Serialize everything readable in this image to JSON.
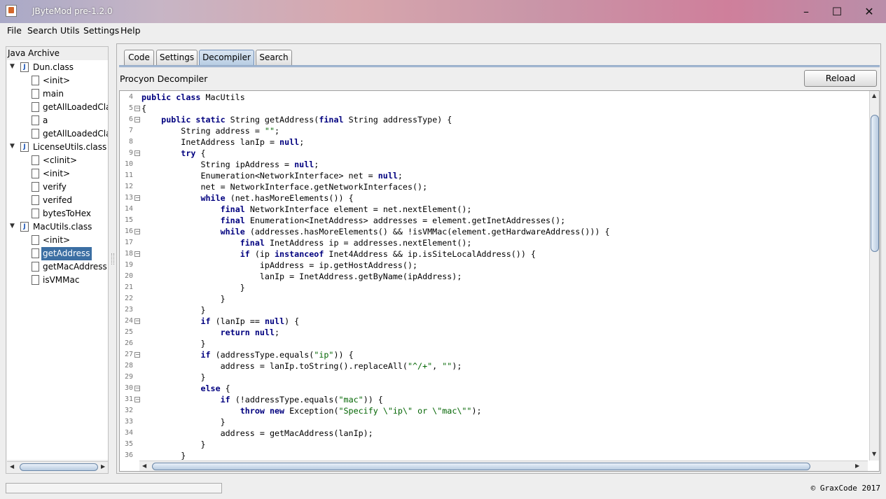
{
  "window": {
    "title": "JByteMod pre-1.2.0",
    "minimize_icon": "minimize-icon",
    "maximize_icon": "maximize-icon",
    "close_icon": "close-icon"
  },
  "menu": [
    "File",
    "Search",
    "Utils",
    "Settings",
    "Help"
  ],
  "sidebar": {
    "title": "Java Archive",
    "nodes": [
      {
        "label": "Dun.class",
        "kind": "class",
        "depth": 0,
        "expanded": true
      },
      {
        "label": "<init>",
        "kind": "method",
        "depth": 1
      },
      {
        "label": "main",
        "kind": "method",
        "depth": 1
      },
      {
        "label": "getAllLoadedClas",
        "kind": "method",
        "depth": 1
      },
      {
        "label": "a",
        "kind": "method",
        "depth": 1
      },
      {
        "label": "getAllLoadedClas",
        "kind": "method",
        "depth": 1
      },
      {
        "label": "LicenseUtils.class",
        "kind": "class",
        "depth": 0,
        "expanded": true
      },
      {
        "label": "<clinit>",
        "kind": "method",
        "depth": 1
      },
      {
        "label": "<init>",
        "kind": "method",
        "depth": 1
      },
      {
        "label": "verify",
        "kind": "method",
        "depth": 1
      },
      {
        "label": "verifed",
        "kind": "method",
        "depth": 1
      },
      {
        "label": "bytesToHex",
        "kind": "method",
        "depth": 1
      },
      {
        "label": "MacUtils.class",
        "kind": "class",
        "depth": 0,
        "expanded": true
      },
      {
        "label": "<init>",
        "kind": "method",
        "depth": 1
      },
      {
        "label": "getAddress",
        "kind": "method",
        "depth": 1,
        "selected": true
      },
      {
        "label": "getMacAddress",
        "kind": "method",
        "depth": 1
      },
      {
        "label": "isVMMac",
        "kind": "method",
        "depth": 1
      }
    ]
  },
  "tabs": [
    {
      "label": "Code"
    },
    {
      "label": "Settings"
    },
    {
      "label": "Decompiler",
      "active": true
    },
    {
      "label": "Search"
    }
  ],
  "decompiler": {
    "title": "Procyon Decompiler",
    "reload_label": "Reload"
  },
  "code_lines": [
    {
      "n": "4",
      "fold": false,
      "parts": [
        [
          "kw",
          "public class "
        ],
        [
          "",
          "MacUtils"
        ]
      ]
    },
    {
      "n": "5",
      "fold": true,
      "parts": [
        [
          "",
          "{"
        ]
      ]
    },
    {
      "n": "6",
      "fold": true,
      "parts": [
        [
          "",
          "    "
        ],
        [
          "kw",
          "public static "
        ],
        [
          "",
          "String getAddress("
        ],
        [
          "kw",
          "final "
        ],
        [
          "",
          "String addressType) {"
        ]
      ]
    },
    {
      "n": "7",
      "fold": false,
      "parts": [
        [
          "",
          "        String address = "
        ],
        [
          "str",
          "\"\""
        ],
        [
          "",
          ";"
        ]
      ]
    },
    {
      "n": "8",
      "fold": false,
      "parts": [
        [
          "",
          "        InetAddress lanIp = "
        ],
        [
          "kw",
          "null"
        ],
        [
          "",
          ";"
        ]
      ]
    },
    {
      "n": "9",
      "fold": true,
      "parts": [
        [
          "",
          "        "
        ],
        [
          "kw",
          "try "
        ],
        [
          "",
          "{"
        ]
      ]
    },
    {
      "n": "10",
      "fold": false,
      "parts": [
        [
          "",
          "            String ipAddress = "
        ],
        [
          "kw",
          "null"
        ],
        [
          "",
          ";"
        ]
      ]
    },
    {
      "n": "11",
      "fold": false,
      "parts": [
        [
          "",
          "            Enumeration<NetworkInterface> net = "
        ],
        [
          "kw",
          "null"
        ],
        [
          "",
          ";"
        ]
      ]
    },
    {
      "n": "12",
      "fold": false,
      "parts": [
        [
          "",
          "            net = NetworkInterface.getNetworkInterfaces();"
        ]
      ]
    },
    {
      "n": "13",
      "fold": true,
      "parts": [
        [
          "",
          "            "
        ],
        [
          "kw",
          "while "
        ],
        [
          "",
          "(net.hasMoreElements()) {"
        ]
      ]
    },
    {
      "n": "14",
      "fold": false,
      "parts": [
        [
          "",
          "                "
        ],
        [
          "kw",
          "final "
        ],
        [
          "",
          "NetworkInterface element = net.nextElement();"
        ]
      ]
    },
    {
      "n": "15",
      "fold": false,
      "parts": [
        [
          "",
          "                "
        ],
        [
          "kw",
          "final "
        ],
        [
          "",
          "Enumeration<InetAddress> addresses = element.getInetAddresses();"
        ]
      ]
    },
    {
      "n": "16",
      "fold": true,
      "parts": [
        [
          "",
          "                "
        ],
        [
          "kw",
          "while "
        ],
        [
          "",
          "(addresses.hasMoreElements() && !isVMMac(element.getHardwareAddress())) {"
        ]
      ]
    },
    {
      "n": "17",
      "fold": false,
      "parts": [
        [
          "",
          "                    "
        ],
        [
          "kw",
          "final "
        ],
        [
          "",
          "InetAddress ip = addresses.nextElement();"
        ]
      ]
    },
    {
      "n": "18",
      "fold": true,
      "parts": [
        [
          "",
          "                    "
        ],
        [
          "kw",
          "if "
        ],
        [
          "",
          "(ip "
        ],
        [
          "kw",
          "instanceof "
        ],
        [
          "",
          "Inet4Address && ip.isSiteLocalAddress()) {"
        ]
      ]
    },
    {
      "n": "19",
      "fold": false,
      "parts": [
        [
          "",
          "                        ipAddress = ip.getHostAddress();"
        ]
      ]
    },
    {
      "n": "20",
      "fold": false,
      "parts": [
        [
          "",
          "                        lanIp = InetAddress.getByName(ipAddress);"
        ]
      ]
    },
    {
      "n": "21",
      "fold": false,
      "parts": [
        [
          "",
          "                    }"
        ]
      ]
    },
    {
      "n": "22",
      "fold": false,
      "parts": [
        [
          "",
          "                }"
        ]
      ]
    },
    {
      "n": "23",
      "fold": false,
      "parts": [
        [
          "",
          "            }"
        ]
      ]
    },
    {
      "n": "24",
      "fold": true,
      "parts": [
        [
          "",
          "            "
        ],
        [
          "kw",
          "if "
        ],
        [
          "",
          "(lanIp == "
        ],
        [
          "kw",
          "null"
        ],
        [
          "",
          ") {"
        ]
      ]
    },
    {
      "n": "25",
      "fold": false,
      "parts": [
        [
          "",
          "                "
        ],
        [
          "kw",
          "return null"
        ],
        [
          "",
          ";"
        ]
      ]
    },
    {
      "n": "26",
      "fold": false,
      "parts": [
        [
          "",
          "            }"
        ]
      ]
    },
    {
      "n": "27",
      "fold": true,
      "parts": [
        [
          "",
          "            "
        ],
        [
          "kw",
          "if "
        ],
        [
          "",
          "(addressType.equals("
        ],
        [
          "str",
          "\"ip\""
        ],
        [
          "",
          ")) {"
        ]
      ]
    },
    {
      "n": "28",
      "fold": false,
      "parts": [
        [
          "",
          "                address = lanIp.toString().replaceAll("
        ],
        [
          "str",
          "\"^/+\""
        ],
        [
          "",
          ", "
        ],
        [
          "str",
          "\"\""
        ],
        [
          "",
          ");"
        ]
      ]
    },
    {
      "n": "29",
      "fold": false,
      "parts": [
        [
          "",
          "            }"
        ]
      ]
    },
    {
      "n": "30",
      "fold": true,
      "parts": [
        [
          "",
          "            "
        ],
        [
          "kw",
          "else "
        ],
        [
          "",
          "{"
        ]
      ]
    },
    {
      "n": "31",
      "fold": true,
      "parts": [
        [
          "",
          "                "
        ],
        [
          "kw",
          "if "
        ],
        [
          "",
          "(!addressType.equals("
        ],
        [
          "str",
          "\"mac\""
        ],
        [
          "",
          ")) {"
        ]
      ]
    },
    {
      "n": "32",
      "fold": false,
      "parts": [
        [
          "",
          "                    "
        ],
        [
          "kw",
          "throw new "
        ],
        [
          "",
          "Exception("
        ],
        [
          "str",
          "\"Specify \\\"ip\\\" or \\\"mac\\\"\""
        ],
        [
          "",
          ");"
        ]
      ]
    },
    {
      "n": "33",
      "fold": false,
      "parts": [
        [
          "",
          "                }"
        ]
      ]
    },
    {
      "n": "34",
      "fold": false,
      "parts": [
        [
          "",
          "                address = getMacAddress(lanIp);"
        ]
      ]
    },
    {
      "n": "35",
      "fold": false,
      "parts": [
        [
          "",
          "            }"
        ]
      ]
    },
    {
      "n": "36",
      "fold": false,
      "parts": [
        [
          "",
          "        }"
        ]
      ]
    }
  ],
  "status": {
    "copyright": "© GraxCode 2017",
    "progress": 0
  }
}
